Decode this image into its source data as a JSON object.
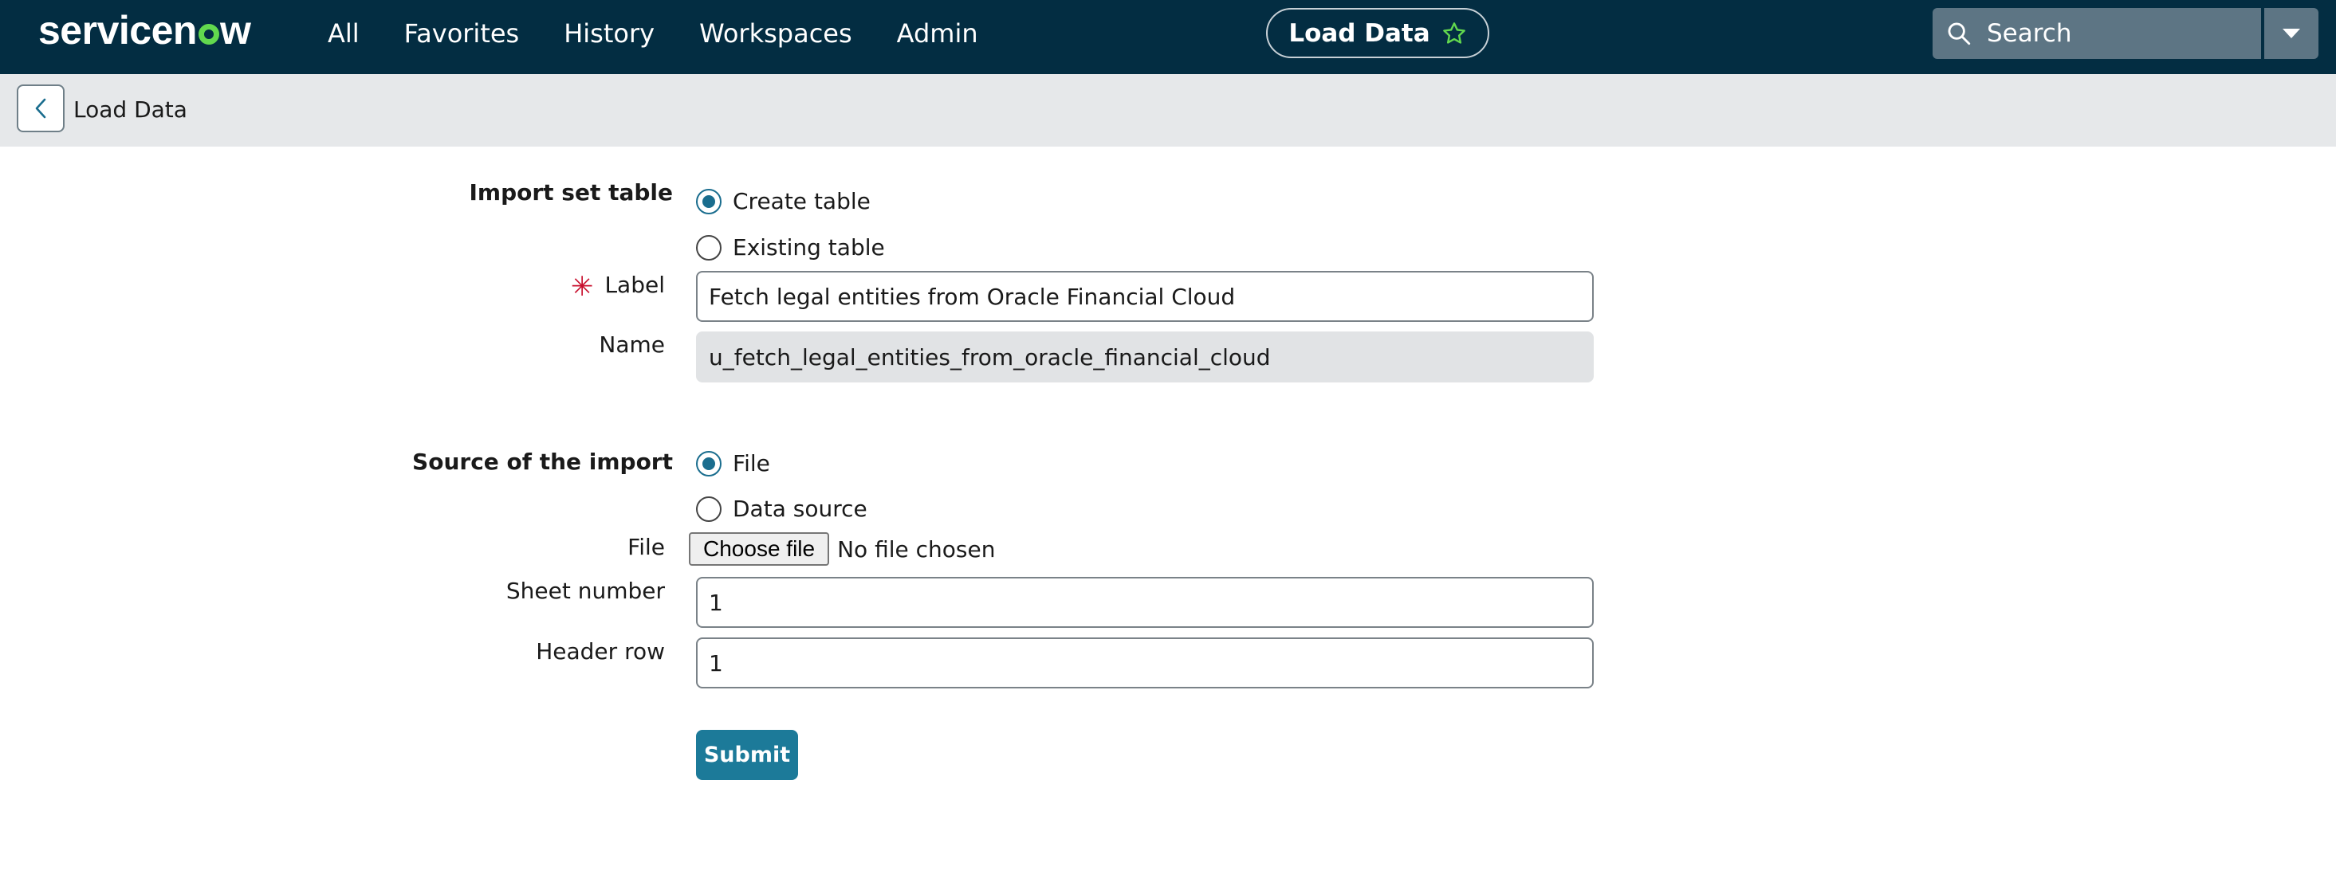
{
  "header": {
    "logo": {
      "part1": "servicen",
      "part2": "w"
    },
    "nav": [
      "All",
      "Favorites",
      "History",
      "Workspaces",
      "Admin"
    ],
    "context_pill": "Load Data",
    "search_placeholder": "Search"
  },
  "subheader": {
    "title": "Load Data"
  },
  "form": {
    "import_set_table": {
      "label": "Import set table",
      "options": [
        "Create table",
        "Existing table"
      ],
      "selected": "Create table"
    },
    "label_field": {
      "label": "Label",
      "value": "Fetch legal entities from Oracle Financial Cloud"
    },
    "name_field": {
      "label": "Name",
      "value": "u_fetch_legal_entities_from_oracle_financial_cloud"
    },
    "source_of_import": {
      "label": "Source of the import",
      "options": [
        "File",
        "Data source"
      ],
      "selected": "File"
    },
    "file_field": {
      "label": "File",
      "button": "Choose file",
      "status": "No file chosen"
    },
    "sheet_number": {
      "label": "Sheet number",
      "value": "1"
    },
    "header_row": {
      "label": "Header row",
      "value": "1"
    },
    "submit": "Submit"
  },
  "colors": {
    "topbar": "#032d42",
    "accent": "#1c7a99",
    "logo_green": "#62d84e",
    "required": "#c8102e"
  }
}
